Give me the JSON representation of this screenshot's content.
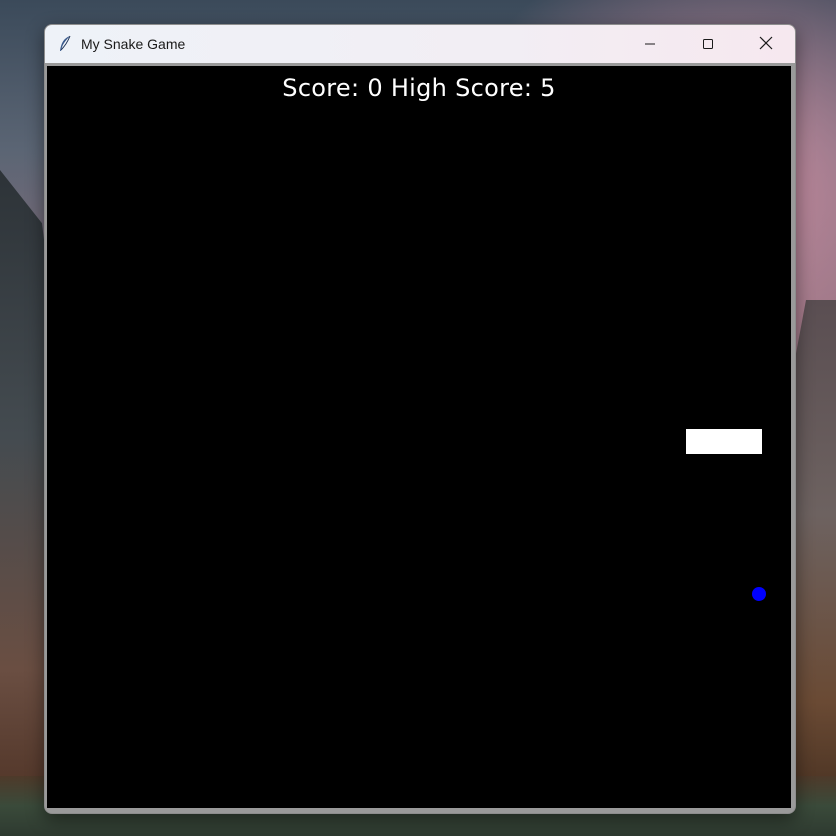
{
  "window": {
    "title": "My Snake Game",
    "app_icon": "feather-icon",
    "controls": [
      "minimize-icon",
      "maximize-icon",
      "close-icon"
    ]
  },
  "game": {
    "score_text": "Score: 0 High Score: 5",
    "score": 0,
    "high_score": 5,
    "background_color": "#000000",
    "snake_color": "#ffffff",
    "food_color": "#0000ff"
  }
}
